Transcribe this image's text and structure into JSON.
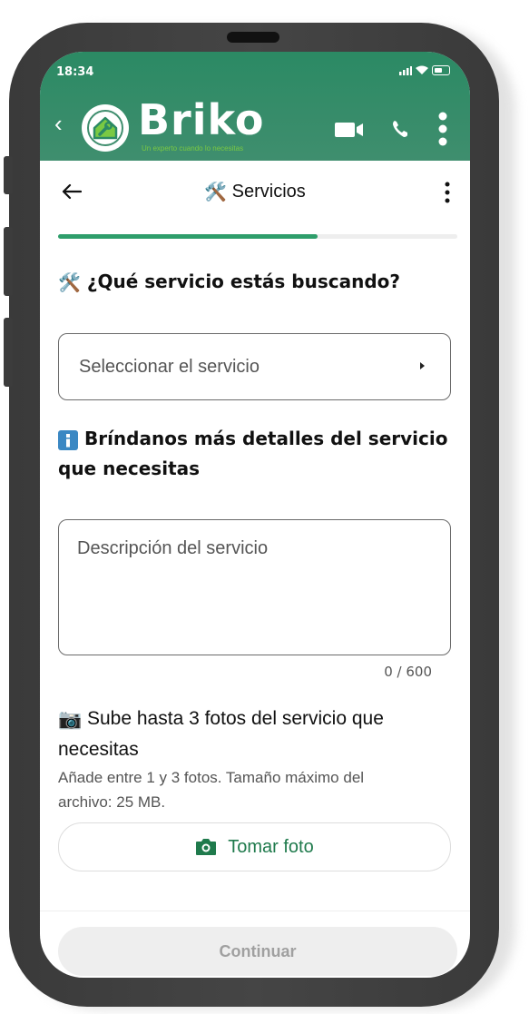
{
  "status_bar": {
    "time": "18:34"
  },
  "app_header": {
    "brand": "Briko",
    "tagline": "Un experto cuando lo necesitas",
    "brand_color": "#2b8a64",
    "accent_color": "#7ac943"
  },
  "subheader": {
    "title": "Servicios"
  },
  "progress": {
    "value": 0.65
  },
  "service_question": {
    "text": "¿Qué servicio estás buscando?",
    "icon": "hammer-wrench-icon"
  },
  "service_select": {
    "placeholder": "Seleccionar el servicio"
  },
  "details_question": {
    "line1": "Bríndanos más detalles del servicio",
    "line2": "que necesitas",
    "icon": "info-icon"
  },
  "description": {
    "placeholder": "Descripción del servicio",
    "counter": "0 / 600"
  },
  "photos": {
    "heading_line1": "Sube hasta 3 fotos del servicio que",
    "heading_line2": "necesitas",
    "hint_line1": "Añade entre 1 y 3 fotos. Tamaño máximo del",
    "hint_line2": "archivo: 25 MB.",
    "button_label": "Tomar foto",
    "icon": "camera-icon"
  },
  "footer": {
    "continue_label": "Continuar"
  }
}
